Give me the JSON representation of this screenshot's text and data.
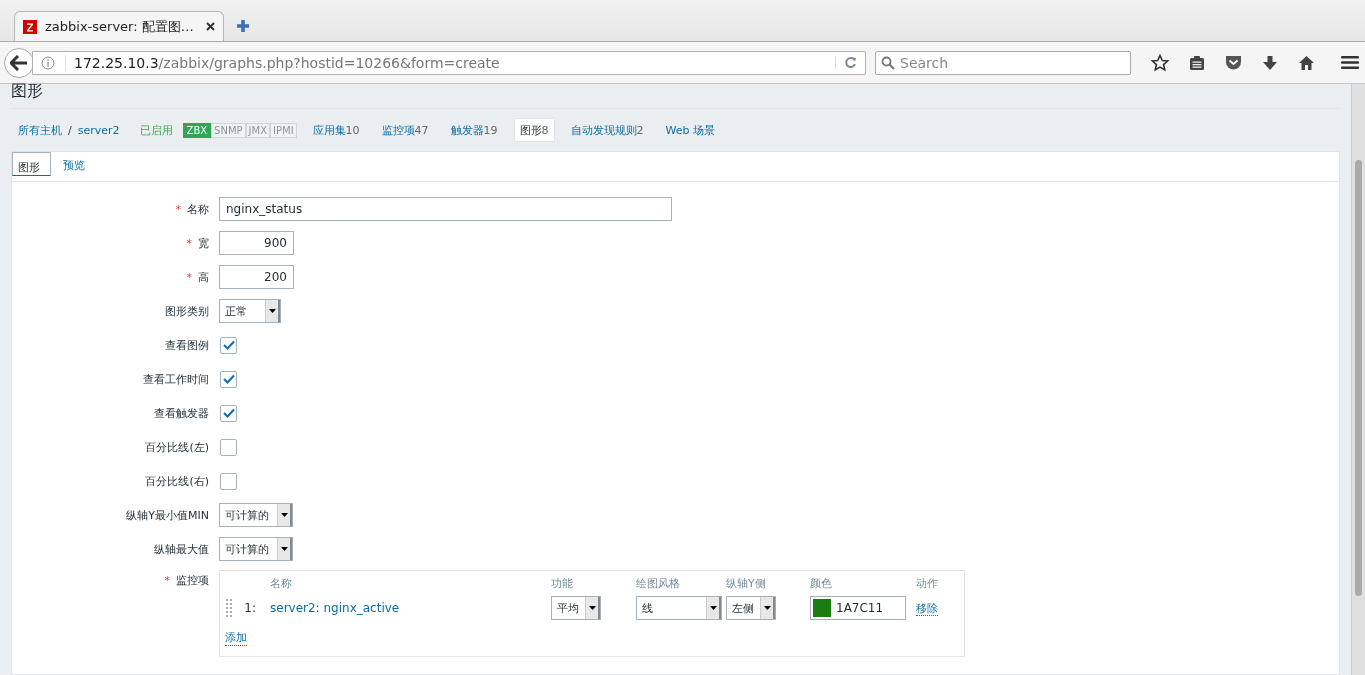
{
  "browser": {
    "tab_title": "zabbix-server: 配置图…",
    "url_host": "172.25.10.3",
    "url_path": "/zabbix/graphs.php?hostid=10266&form=create",
    "search_placeholder": "Search"
  },
  "page_title": "图形",
  "required_mark": "*",
  "host_nav": {
    "breadcrumbs": [
      "所有主机",
      "server2"
    ],
    "separator": "/",
    "status": "已启用",
    "interfaces": [
      {
        "label": "ZBX",
        "on": true
      },
      {
        "label": "SNMP",
        "on": false
      },
      {
        "label": "JMX",
        "on": false
      },
      {
        "label": "IPMI",
        "on": false
      }
    ],
    "links": [
      {
        "label": "应用集",
        "count": "10",
        "selected": false
      },
      {
        "label": "监控项",
        "count": "47",
        "selected": false
      },
      {
        "label": "触发器",
        "count": "19",
        "selected": false
      },
      {
        "label": "图形",
        "count": "8",
        "selected": true
      },
      {
        "label": "自动发现规则",
        "count": "2",
        "selected": false
      },
      {
        "label": "Web 场景",
        "selected": false
      }
    ]
  },
  "tabs": [
    {
      "label": "图形",
      "selected": true
    },
    {
      "label": "预览",
      "selected": false
    }
  ],
  "fields": [
    {
      "label": "名称",
      "required": true,
      "kind": "text",
      "value": "nginx_status"
    },
    {
      "label": "宽",
      "required": true,
      "kind": "number",
      "value": "900"
    },
    {
      "label": "高",
      "required": true,
      "kind": "number",
      "value": "200"
    },
    {
      "label": "图形类别",
      "required": false,
      "kind": "select",
      "value": "正常"
    },
    {
      "label": "查看图例",
      "required": false,
      "kind": "checkbox",
      "checked": true
    },
    {
      "label": "查看工作时间",
      "required": false,
      "kind": "checkbox",
      "checked": true
    },
    {
      "label": "查看触发器",
      "required": false,
      "kind": "checkbox",
      "checked": true
    },
    {
      "label": "百分比线(左)",
      "required": false,
      "kind": "checkbox",
      "checked": false
    },
    {
      "label": "百分比线(右)",
      "required": false,
      "kind": "checkbox",
      "checked": false
    },
    {
      "label": "纵轴Y最小值MIN",
      "required": false,
      "kind": "select-wide",
      "value": "可计算的"
    },
    {
      "label": "纵轴最大值",
      "required": false,
      "kind": "select-wide",
      "value": "可计算的"
    }
  ],
  "items": {
    "label": "监控项",
    "required": true,
    "columns": [
      "名称",
      "功能",
      "绘图风格",
      "纵轴Y侧",
      "颜色",
      "动作"
    ],
    "rows": [
      {
        "index": "1:",
        "name": "server2: nginx_active",
        "function": "平均",
        "style": "线",
        "side": "左侧",
        "color": "#1a7c11",
        "color_text": "1A7C11",
        "action": "移除"
      }
    ],
    "add": "添加"
  }
}
